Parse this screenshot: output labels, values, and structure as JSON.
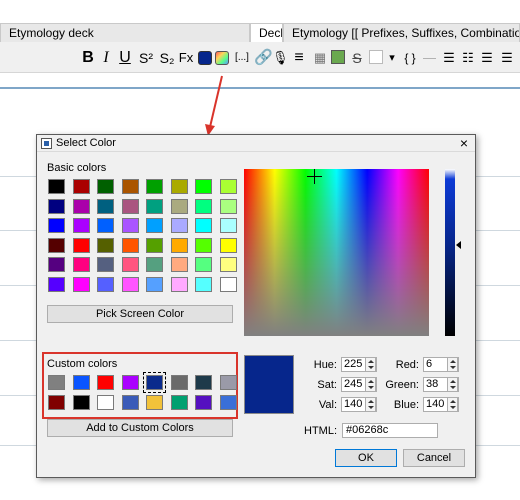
{
  "tabs": [
    {
      "label": "Etymology deck"
    },
    {
      "label": "Deck"
    },
    {
      "label": "Etymology [[ Prefixes, Suffixes, Combination forms v"
    }
  ],
  "toolbar": {
    "bold": "B",
    "italic": "I",
    "underline": "U",
    "superscript": "S²",
    "subscript": "S₂",
    "clear_format": "Fx",
    "cloze": "[...]",
    "mic": "🎙",
    "list_bullet": "≡",
    "more": "▾",
    "braces": "{ }",
    "strike": "S"
  },
  "dialog": {
    "title": "Select Color",
    "close": "×",
    "basic_colors_label": "Basic colors",
    "pick_screen_label": "Pick Screen Color",
    "custom_colors_label": "Custom colors",
    "add_custom_label": "Add to Custom Colors",
    "ok_label": "OK",
    "cancel_label": "Cancel",
    "basic_colors": [
      [
        "#000000",
        "#aa0000",
        "#006000",
        "#aa5500",
        "#00a000",
        "#aaaa00",
        "#00ff00",
        "#aaff33"
      ],
      [
        "#000080",
        "#aa00aa",
        "#006080",
        "#aa5580",
        "#00a080",
        "#aaaa80",
        "#00ff80",
        "#aaff80"
      ],
      [
        "#0000ff",
        "#aa00ff",
        "#0060ff",
        "#aa55ff",
        "#00a0ff",
        "#aaaaff",
        "#00ffff",
        "#aaffff"
      ],
      [
        "#550000",
        "#ff0000",
        "#556000",
        "#ff5500",
        "#55a000",
        "#ffaa00",
        "#55ff00",
        "#ffff00"
      ],
      [
        "#550080",
        "#ff0080",
        "#556080",
        "#ff5580",
        "#55a080",
        "#ffaa80",
        "#55ff80",
        "#ffff80"
      ],
      [
        "#5500ff",
        "#ff00ff",
        "#5560ff",
        "#ff55ff",
        "#55a0ff",
        "#ffaaff",
        "#55ffff",
        "#ffffff"
      ]
    ],
    "custom_colors": [
      [
        "#808080",
        "#0a55ff",
        "#ff0000",
        "#aa00ff",
        "#0a2a8c",
        "#6a6a6a",
        "#1e3a4a",
        "#9a9aa8"
      ],
      [
        "#800000",
        "#000000",
        "#ffffff",
        "#3a5ab8",
        "#f2c23a",
        "#00a070",
        "#5510c0",
        "#3a6fd8"
      ]
    ],
    "selected_custom_index": 4,
    "current_color": "#06268c",
    "fields": {
      "hue_label": "Hue:",
      "hue": "225",
      "sat_label": "Sat:",
      "sat": "245",
      "val_label": "Val:",
      "val": "140",
      "red_label": "Red:",
      "red": "6",
      "green_label": "Green:",
      "green": "38",
      "blue_label": "Blue:",
      "blue": "140",
      "html_label": "HTML:",
      "html": "#06268c"
    }
  },
  "colors": {
    "annotation_red": "#d9342b",
    "accent": "#0078d7"
  }
}
